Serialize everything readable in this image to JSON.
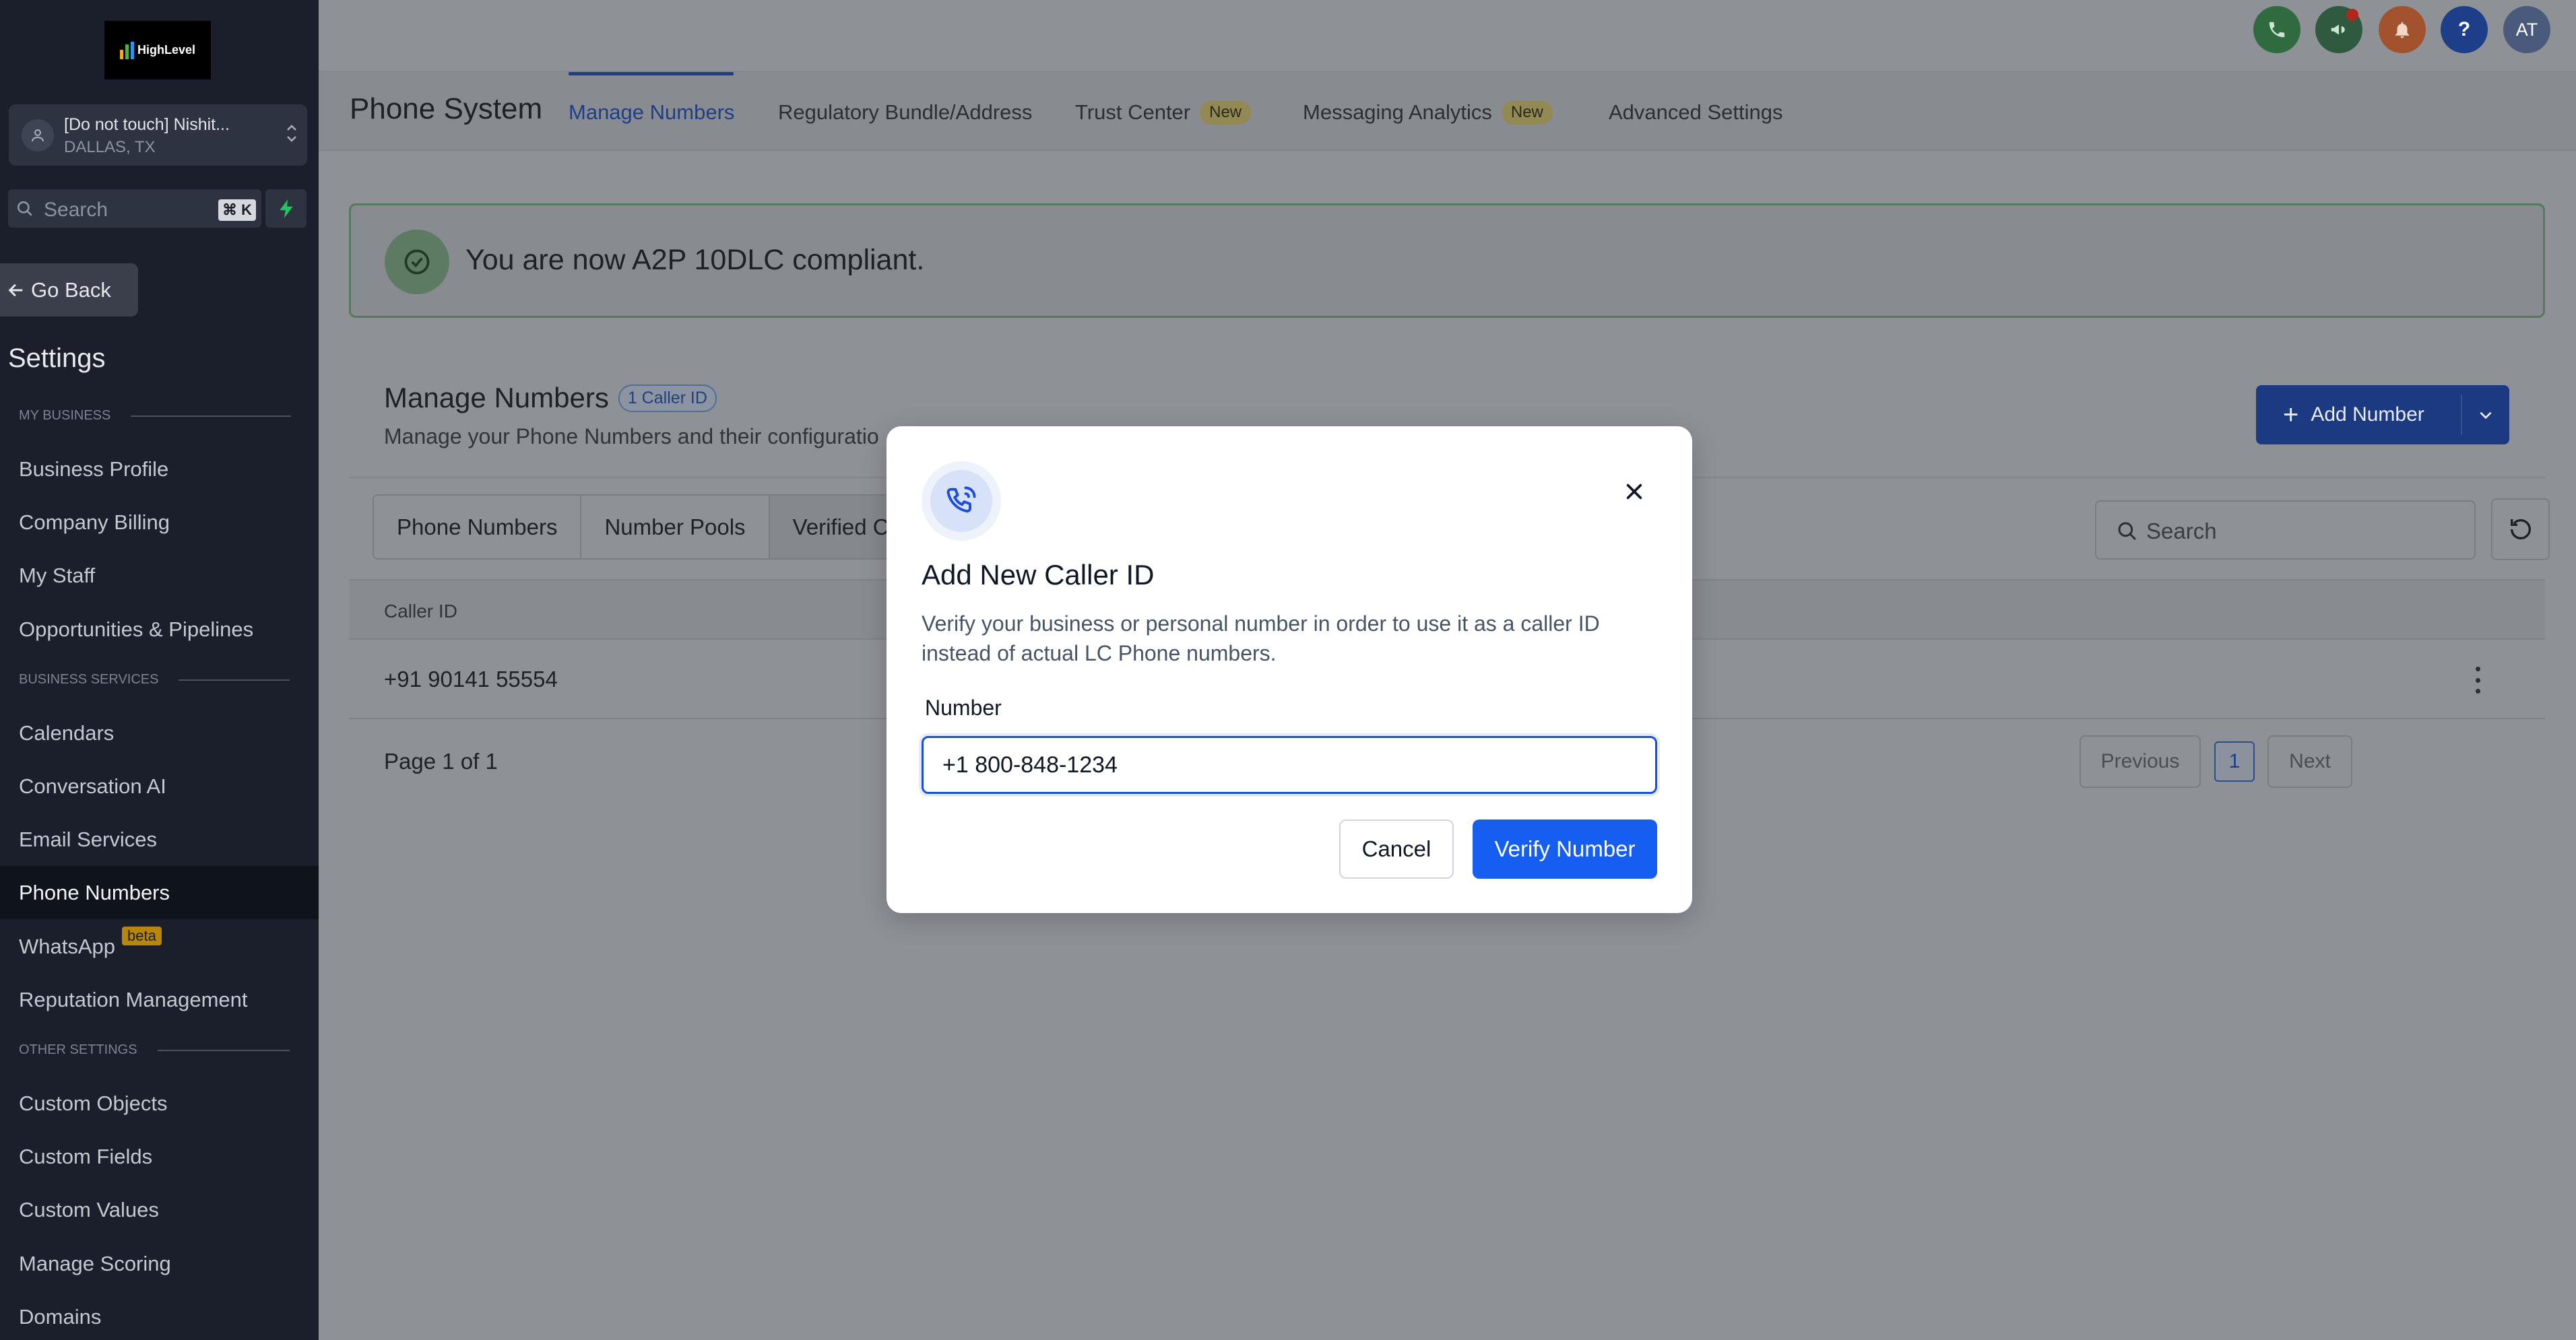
{
  "sidebar": {
    "logo_text": "HighLevel",
    "location": {
      "name": "[Do not touch] Nishit...",
      "city": "DALLAS, TX"
    },
    "search": {
      "placeholder": "Search",
      "shortcut": "⌘ K"
    },
    "go_back": "Go Back",
    "settings_title": "Settings",
    "sections": [
      {
        "label": "MY BUSINESS"
      },
      {
        "label": "BUSINESS SERVICES"
      },
      {
        "label": "OTHER SETTINGS"
      }
    ],
    "items": [
      {
        "label": "Business Profile"
      },
      {
        "label": "Company Billing"
      },
      {
        "label": "My Staff"
      },
      {
        "label": "Opportunities & Pipelines"
      },
      {
        "label": "Calendars"
      },
      {
        "label": "Conversation AI"
      },
      {
        "label": "Email Services"
      },
      {
        "label": "Phone Numbers",
        "active": true
      },
      {
        "label": "WhatsApp",
        "badge": "beta"
      },
      {
        "label": "Reputation Management"
      },
      {
        "label": "Custom Objects"
      },
      {
        "label": "Custom Fields"
      },
      {
        "label": "Custom Values"
      },
      {
        "label": "Manage Scoring"
      },
      {
        "label": "Domains"
      }
    ]
  },
  "topbar": {
    "avatar_initials": "AT",
    "help_glyph": "?",
    "icons": [
      "phone-icon",
      "megaphone-icon",
      "bell-icon",
      "help-icon",
      "avatar"
    ]
  },
  "header": {
    "title": "Phone System",
    "tabs": [
      {
        "label": "Manage Numbers",
        "active": true
      },
      {
        "label": "Regulatory Bundle/Address"
      },
      {
        "label": "Trust Center",
        "badge": "New"
      },
      {
        "label": "Messaging Analytics",
        "badge": "New"
      },
      {
        "label": "Advanced Settings"
      }
    ]
  },
  "alert": {
    "text": "You are now A2P 10DLC compliant."
  },
  "card": {
    "title": "Manage Numbers",
    "badge": "1 Caller ID",
    "subtitle": "Manage your Phone Numbers and their configuratio",
    "add_button": "Add Number",
    "segments": [
      "Phone Numbers",
      "Number Pools",
      "Verified C"
    ],
    "search_placeholder": "Search",
    "table": {
      "columns": [
        "Caller ID"
      ],
      "rows": [
        {
          "caller_id": "+91 90141 55554"
        }
      ]
    },
    "pagination": {
      "info": "Page 1 of 1",
      "previous": "Previous",
      "current": "1",
      "next": "Next"
    }
  },
  "modal": {
    "title": "Add New Caller ID",
    "description": "Verify your business or personal number in order to use it as a caller ID instead of actual LC Phone numbers.",
    "field_label": "Number",
    "field_value": "+1 800-848-1234",
    "cancel": "Cancel",
    "verify": "Verify Number"
  },
  "colors": {
    "primary": "#155eef",
    "sidebar_bg": "#1a1f2b",
    "overlay": "#8e9196",
    "success": "#54795d"
  }
}
